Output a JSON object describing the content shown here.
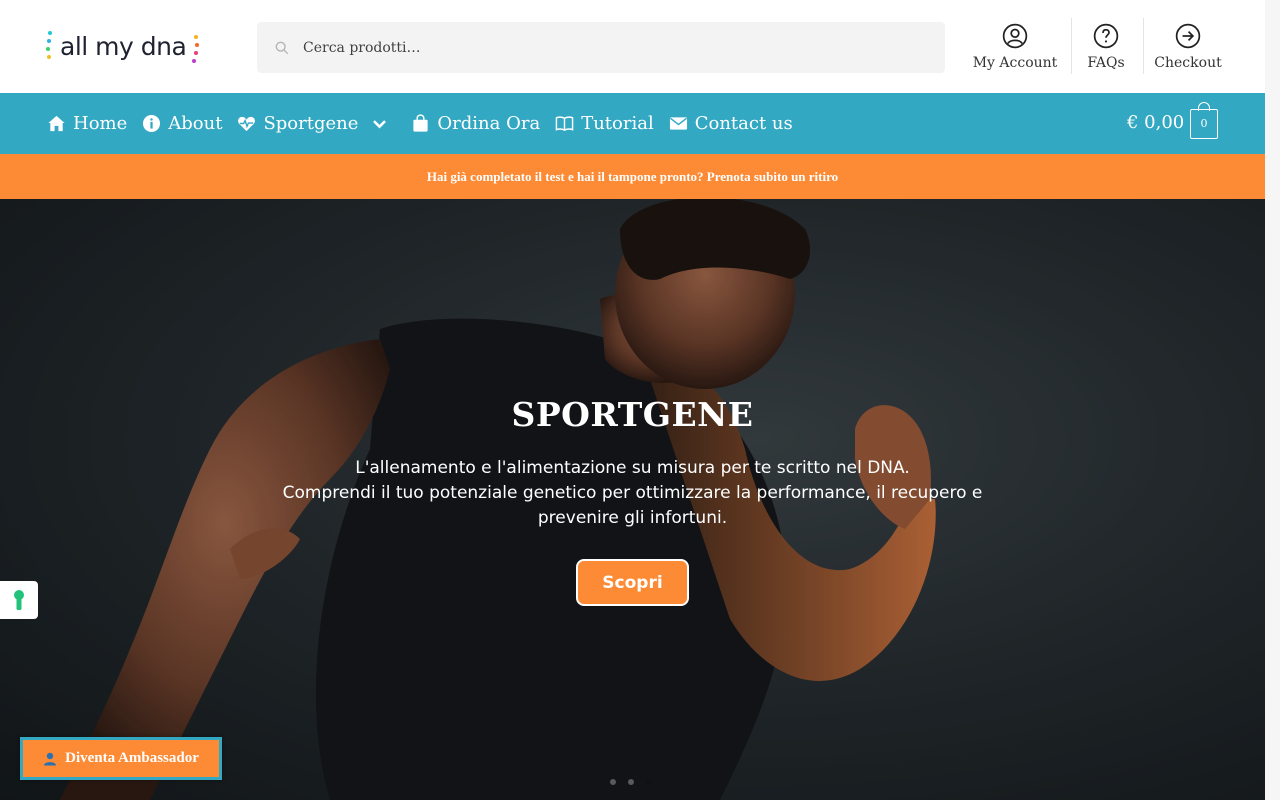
{
  "header": {
    "logo_text": "all my dna",
    "search": {
      "placeholder": "Cerca prodotti…"
    },
    "account_links": [
      {
        "label": "My Account",
        "icon": "user-circle-icon"
      },
      {
        "label": "FAQs",
        "icon": "question-circle-icon"
      },
      {
        "label": "Checkout",
        "icon": "arrow-right-circle-icon"
      }
    ]
  },
  "nav": {
    "items": [
      {
        "label": "Home",
        "icon": "home-icon"
      },
      {
        "label": "About",
        "icon": "info-icon"
      },
      {
        "label": "Sportgene",
        "icon": "heartbeat-icon",
        "has_dropdown": true
      },
      {
        "label": "Ordina Ora",
        "icon": "shopping-bag-icon"
      },
      {
        "label": "Tutorial",
        "icon": "book-icon"
      },
      {
        "label": "Contact us",
        "icon": "envelope-icon"
      }
    ],
    "cart_total": "€ 0,00",
    "cart_count": "0"
  },
  "announcement": "Hai già completato il test e hai il tampone pronto? Prenota subito un ritiro",
  "hero": {
    "title": "SPORTGENE",
    "subtitle_lines": [
      "L'allenamento e l'alimentazione su misura per te scritto nel DNA.",
      "Comprendi il tuo potenziale genetico per ottimizzare la performance, il recupero e",
      "prevenire gli infortuni."
    ],
    "button": "Scopri",
    "slider_active_index": 2
  },
  "ambassador_button": "Diventa Ambassador",
  "colors": {
    "brand_teal": "#33a8c3",
    "accent_orange": "#fd8a34"
  }
}
